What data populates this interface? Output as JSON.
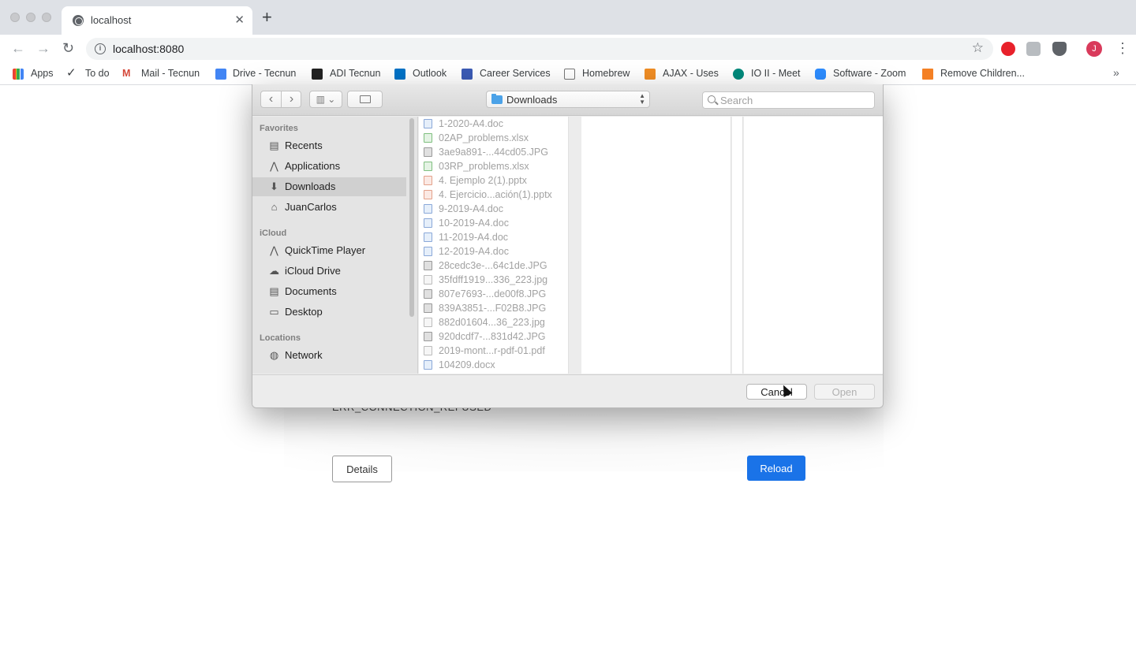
{
  "browser": {
    "tab_title": "localhost",
    "tab_close": "✕",
    "new_tab": "+",
    "url": "localhost:8080",
    "avatar_initial": "J",
    "back": "←",
    "forward": "→",
    "reload": "↻",
    "star": "☆",
    "info": "i",
    "kebab": "⋮",
    "more_bookmarks": "»"
  },
  "bookmarks": [
    {
      "label": "Apps",
      "icon": "apps-grid-icon",
      "color": "#4285f4"
    },
    {
      "label": "To do",
      "icon": "check-icon",
      "color": "#222222"
    },
    {
      "label": "Mail - Tecnun",
      "icon": "gmail-icon",
      "color": "#d44638"
    },
    {
      "label": "Drive - Tecnun",
      "icon": "docs-icon",
      "color": "#4285f4"
    },
    {
      "label": "ADI Tecnun",
      "icon": "blackboard-icon",
      "color": "#222222"
    },
    {
      "label": "Outlook",
      "icon": "outlook-icon",
      "color": "#0072c6"
    },
    {
      "label": "Career Services",
      "icon": "book-icon",
      "color": "#3b5bb5"
    },
    {
      "label": "Homebrew",
      "icon": "homebrew-icon",
      "color": "#777777"
    },
    {
      "label": "AJAX - Uses",
      "icon": "ajax-icon",
      "color": "#f08d24"
    },
    {
      "label": "IO II - Meet",
      "icon": "meet-icon",
      "color": "#00897b"
    },
    {
      "label": "Software - Zoom",
      "icon": "zoom-icon",
      "color": "#2d8cff"
    },
    {
      "label": "Remove Children...",
      "icon": "stackoverflow-icon",
      "color": "#f48024"
    }
  ],
  "page": {
    "error_text": "ERR_CONNECTION_REFUSED",
    "details_label": "Details",
    "reload_label": "Reload"
  },
  "dialog": {
    "location": "Downloads",
    "search_placeholder": "Search",
    "back": "‹",
    "forward": "›",
    "view_toggle": "▥ ⌄",
    "sidebar": {
      "favorites_heading": "Favorites",
      "favorites": [
        {
          "label": "Recents",
          "icon": "recents-icon",
          "glyph": "▤"
        },
        {
          "label": "Applications",
          "icon": "applications-icon",
          "glyph": "⋀"
        },
        {
          "label": "Downloads",
          "icon": "downloads-icon",
          "glyph": "⬇",
          "selected": true
        },
        {
          "label": "JuanCarlos",
          "icon": "home-icon",
          "glyph": "⌂"
        }
      ],
      "icloud_heading": "iCloud",
      "icloud": [
        {
          "label": "QuickTime Player",
          "icon": "quicktime-icon",
          "glyph": "⋀"
        },
        {
          "label": "iCloud Drive",
          "icon": "cloud-icon",
          "glyph": "☁"
        },
        {
          "label": "Documents",
          "icon": "documents-icon",
          "glyph": "▤"
        },
        {
          "label": "Desktop",
          "icon": "desktop-icon",
          "glyph": "▭"
        }
      ],
      "locations_heading": "Locations",
      "locations": [
        {
          "label": "Network",
          "icon": "network-icon",
          "glyph": "◍"
        }
      ]
    },
    "files": [
      {
        "name": "1-2020-A4.doc",
        "type": "doc"
      },
      {
        "name": "02AP_problems.xlsx",
        "type": "xls"
      },
      {
        "name": "3ae9a891-...44cd05.JPG",
        "type": "img"
      },
      {
        "name": "03RP_problems.xlsx",
        "type": "xls"
      },
      {
        "name": "4. Ejemplo 2(1).pptx",
        "type": "ppt"
      },
      {
        "name": "4. Ejercicio...ación(1).pptx",
        "type": "ppt"
      },
      {
        "name": "9-2019-A4.doc",
        "type": "doc"
      },
      {
        "name": "10-2019-A4.doc",
        "type": "doc"
      },
      {
        "name": "11-2019-A4.doc",
        "type": "doc"
      },
      {
        "name": "12-2019-A4.doc",
        "type": "doc"
      },
      {
        "name": "28cedc3e-...64c1de.JPG",
        "type": "img"
      },
      {
        "name": "35fdff1919...336_223.jpg",
        "type": "pdf"
      },
      {
        "name": "807e7693-...de00f8.JPG",
        "type": "img"
      },
      {
        "name": "839A3851-...F02B8.JPG",
        "type": "img"
      },
      {
        "name": "882d01604...36_223.jpg",
        "type": "pdf"
      },
      {
        "name": "920dcdf7-...831d42.JPG",
        "type": "img"
      },
      {
        "name": "2019-mont...r-pdf-01.pdf",
        "type": "pdf"
      },
      {
        "name": "104209.docx",
        "type": "doc"
      }
    ],
    "cancel_label": "Cancel",
    "open_label": "Open"
  }
}
